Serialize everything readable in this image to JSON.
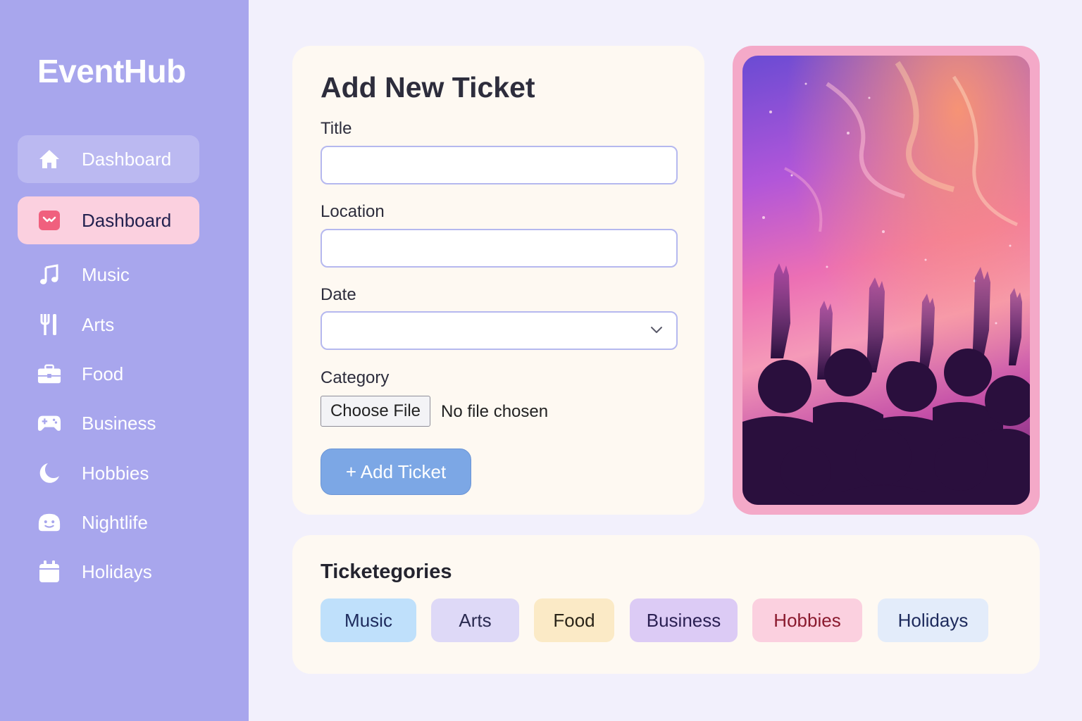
{
  "app": {
    "brand": "EventHub"
  },
  "sidebar": {
    "items": [
      {
        "label": "Dashboard",
        "icon": "home-icon",
        "state": "hover"
      },
      {
        "label": "Dashboard",
        "icon": "inbox-icon",
        "state": "active"
      },
      {
        "label": "Music",
        "icon": "music-note-icon"
      },
      {
        "label": "Arts",
        "icon": "fork-knife-icon"
      },
      {
        "label": "Food",
        "icon": "briefcase-icon"
      },
      {
        "label": "Business",
        "icon": "gamepad-icon"
      },
      {
        "label": "Hobbies",
        "icon": "moon-icon"
      },
      {
        "label": "Nightlife",
        "icon": "smiley-icon"
      },
      {
        "label": "Holidays",
        "icon": "calendar-icon"
      }
    ]
  },
  "form": {
    "title": "Add New Ticket",
    "title_label": "Title",
    "title_value": "",
    "location_label": "Location",
    "location_value": "",
    "date_label": "Date",
    "date_value": "",
    "category_label": "Category",
    "file_button": "Choose File",
    "file_status": "No file chosen",
    "submit_label": "+ Add Ticket"
  },
  "hero_image": {
    "subject": "concert crowd with raised hands"
  },
  "categories": {
    "title": "Ticketegories",
    "chips": [
      {
        "label": "Music",
        "bg": "#bfe0fb",
        "fg": "#1d2a5c"
      },
      {
        "label": "Arts",
        "bg": "#ded9f7",
        "fg": "#2a2a50"
      },
      {
        "label": "Food",
        "bg": "#fbeac6",
        "fg": "#2a2418"
      },
      {
        "label": "Business",
        "bg": "#dccbf5",
        "fg": "#2a1f52"
      },
      {
        "label": "Hobbies",
        "bg": "#fbd0df",
        "fg": "#8a1a2e"
      },
      {
        "label": "Holidays",
        "bg": "#e3ecfa",
        "fg": "#1d2a5c"
      }
    ]
  },
  "colors": {
    "sidebar": "#a8a6ed",
    "accent": "#7ca7e5",
    "frame": "#f4a9c8"
  }
}
